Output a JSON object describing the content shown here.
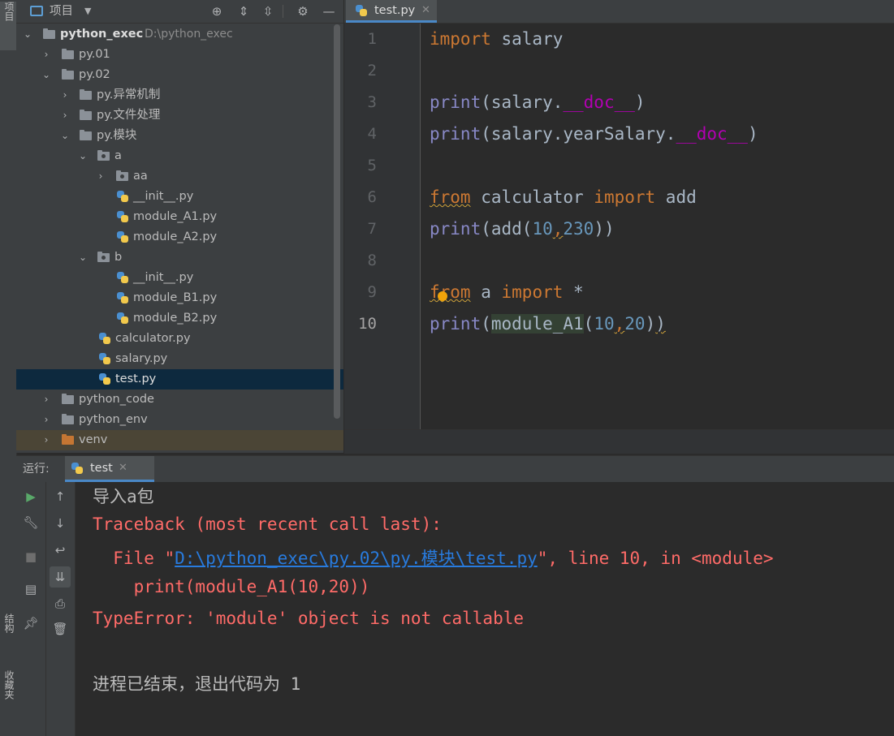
{
  "left_strip": {
    "project_tab": "项目",
    "structure_tab": "结构",
    "favorites_tab": "收藏夹"
  },
  "project_panel": {
    "title": "项目",
    "tree": [
      {
        "label": "python_exec",
        "path": "D:\\python_exec",
        "type": "folder",
        "depth": 0,
        "expanded": true
      },
      {
        "label": "py.01",
        "type": "folder",
        "depth": 1,
        "expanded": false
      },
      {
        "label": "py.02",
        "type": "folder",
        "depth": 1,
        "expanded": true
      },
      {
        "label": "py.异常机制",
        "type": "folder",
        "depth": 2,
        "expanded": false
      },
      {
        "label": "py.文件处理",
        "type": "folder",
        "depth": 2,
        "expanded": false
      },
      {
        "label": "py.模块",
        "type": "folder",
        "depth": 2,
        "expanded": true
      },
      {
        "label": "a",
        "type": "package",
        "depth": 3,
        "expanded": true
      },
      {
        "label": "aa",
        "type": "package",
        "depth": 4,
        "expanded": false
      },
      {
        "label": "__init__.py",
        "type": "python",
        "depth": 5
      },
      {
        "label": "module_A1.py",
        "type": "python",
        "depth": 5
      },
      {
        "label": "module_A2.py",
        "type": "python",
        "depth": 5
      },
      {
        "label": "b",
        "type": "package",
        "depth": 3,
        "expanded": true
      },
      {
        "label": "__init__.py",
        "type": "python",
        "depth": 5
      },
      {
        "label": "module_B1.py",
        "type": "python",
        "depth": 5
      },
      {
        "label": "module_B2.py",
        "type": "python",
        "depth": 5
      },
      {
        "label": "calculator.py",
        "type": "python",
        "depth": 4
      },
      {
        "label": "salary.py",
        "type": "python",
        "depth": 4
      },
      {
        "label": "test.py",
        "type": "python",
        "depth": 4,
        "selected": true
      },
      {
        "label": "python_code",
        "type": "folder",
        "depth": 1,
        "expanded": false
      },
      {
        "label": "python_env",
        "type": "folder",
        "depth": 1,
        "expanded": false
      },
      {
        "label": "venv",
        "type": "excluded",
        "depth": 1,
        "expanded": false
      }
    ]
  },
  "editor": {
    "tab_label": "test.py",
    "line_numbers": [
      "1",
      "2",
      "3",
      "4",
      "5",
      "6",
      "7",
      "8",
      "9",
      "10"
    ],
    "current_line": "10"
  },
  "run_panel": {
    "label": "运行:",
    "tab_label": "test",
    "output": {
      "line1": "导入a包",
      "traceback": "Traceback (most recent call last):",
      "file_prefix": "  File \"",
      "file_path": "D:\\python_exec\\py.02\\py.模块\\test.py",
      "file_suffix": "\", line 10, in <module>",
      "code_line": "    print(module_A1(10,20))",
      "error": "TypeError: 'module' object is not callable",
      "exit": "进程已结束，退出代码为 1"
    }
  },
  "colors": {
    "keyword": "#cc7832",
    "builtin": "#8888c6",
    "dunder": "#b200b2",
    "number": "#6897bb",
    "error_text": "#ff6b68",
    "link": "#287bde"
  }
}
